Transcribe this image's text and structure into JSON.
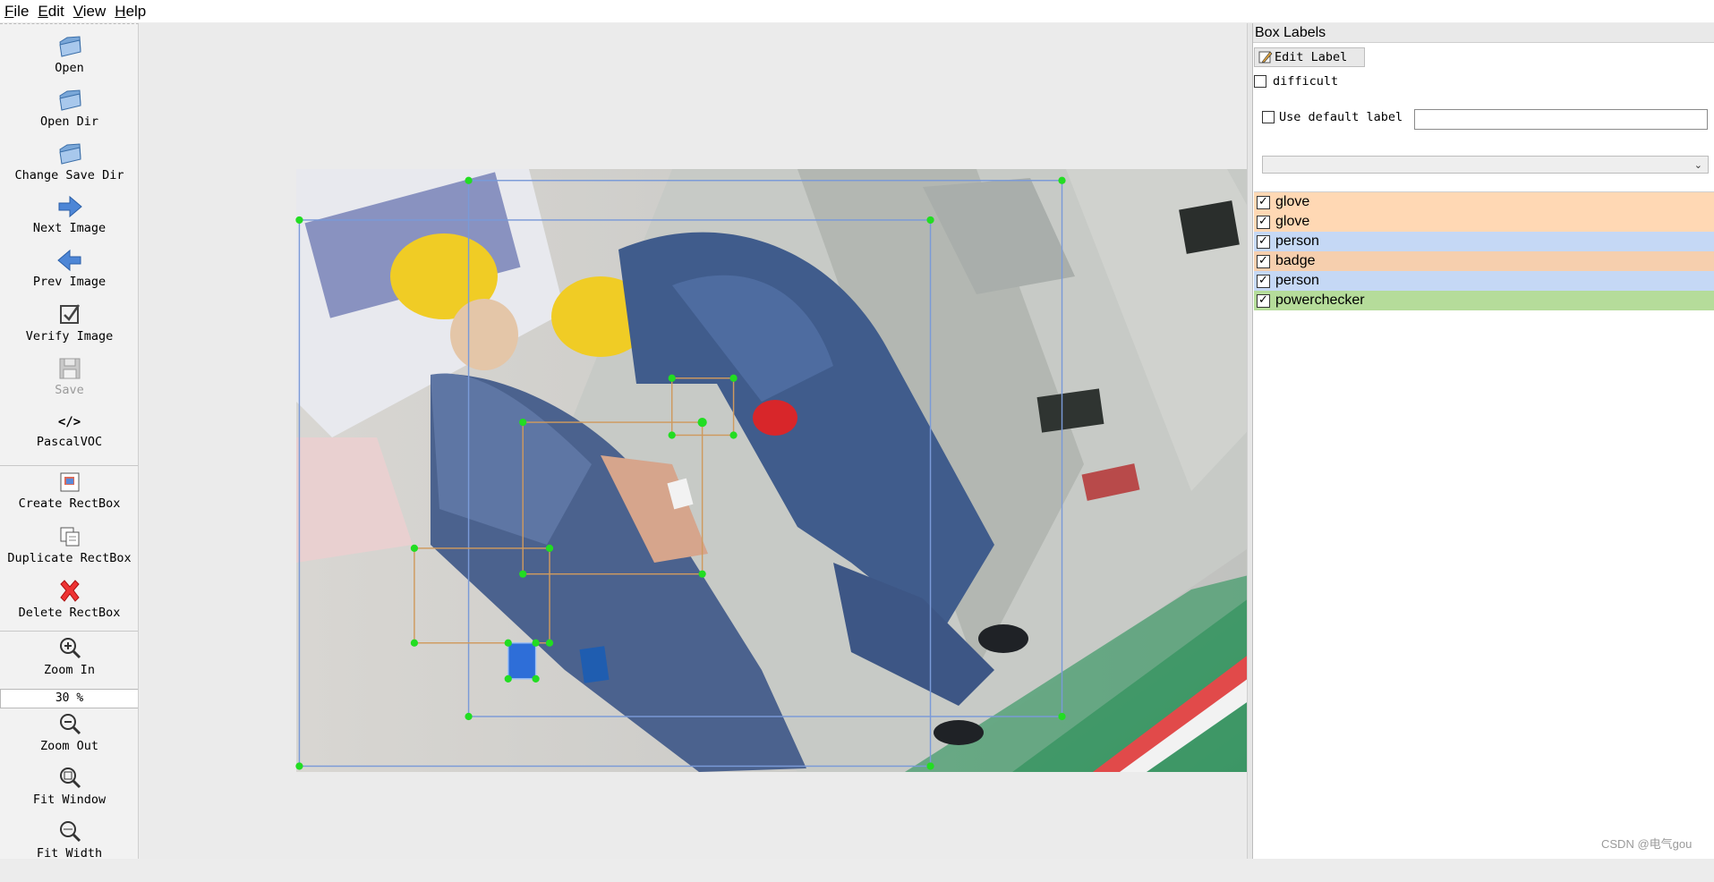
{
  "menu": [
    {
      "label": "File",
      "ul": "F",
      "rest": "ile"
    },
    {
      "label": "Edit",
      "ul": "E",
      "rest": "dit"
    },
    {
      "label": "View",
      "ul": "V",
      "rest": "iew"
    },
    {
      "label": "Help",
      "ul": "H",
      "rest": "elp"
    }
  ],
  "toolbar": {
    "open": "Open",
    "open_dir": "Open Dir",
    "change_save_dir": "Change Save Dir",
    "next_image": "Next Image",
    "prev_image": "Prev Image",
    "verify_image": "Verify Image",
    "save": "Save",
    "format": "PascalVOC",
    "create_rectbox": "Create RectBox",
    "duplicate_rectbox": "Duplicate RectBox",
    "delete_rectbox": "Delete RectBox",
    "zoom_in": "Zoom In",
    "zoom_value": "30 %",
    "zoom_out": "Zoom Out",
    "fit_window": "Fit Window",
    "fit_width": "Fit Width"
  },
  "dock": {
    "title": "Box Labels",
    "edit_label": "Edit Label",
    "difficult": "difficult",
    "use_default_label": "Use default label",
    "default_label_value": ""
  },
  "labels": [
    {
      "name": "glove",
      "checked": true,
      "color": "#ffd8b4"
    },
    {
      "name": "glove",
      "checked": true,
      "color": "#ffd8b4"
    },
    {
      "name": "person",
      "checked": true,
      "color": "#c5d8f5"
    },
    {
      "name": "badge",
      "checked": true,
      "color": "#f6cfae"
    },
    {
      "name": "person",
      "checked": true,
      "color": "#c5d8f5"
    },
    {
      "name": "powerchecker",
      "checked": true,
      "color": "#b5dc9a"
    }
  ],
  "colors": {
    "box_person": "#6f8fd0",
    "box_glove": "#d9a060",
    "handle": "#22dd22",
    "selected_fill": "#2e6ed8"
  },
  "watermark": "CSDN @电气gou"
}
